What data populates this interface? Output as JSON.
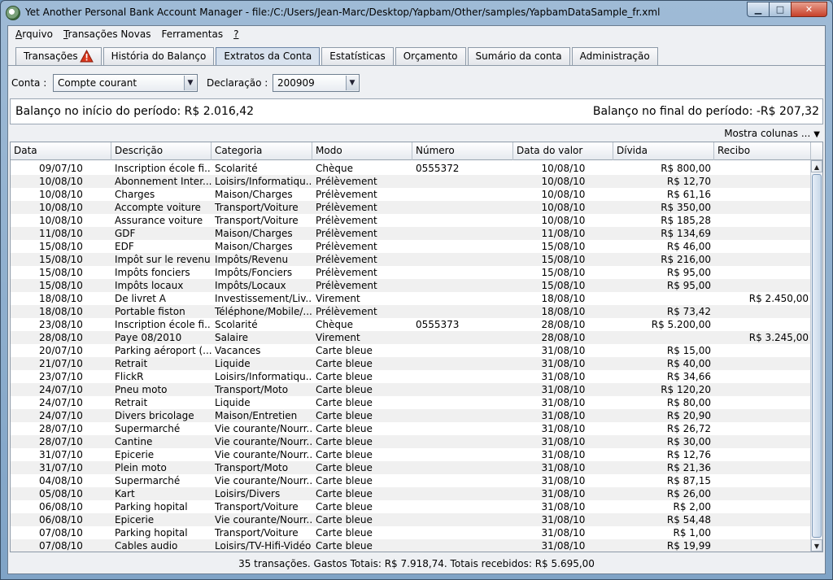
{
  "window": {
    "title": "Yet Another Personal Bank Account Manager - file:/C:/Users/Jean-Marc/Desktop/Yapbam/Other/samples/YapbamDataSample_fr.xml",
    "minimize_glyph": "▁",
    "maximize_glyph": "□",
    "close_glyph": "✕"
  },
  "menu": {
    "items": [
      {
        "label": "Arquivo",
        "mnemonic": "A",
        "rest": "rquivo"
      },
      {
        "label": "Transações Novas",
        "mnemonic": "T",
        "rest": "ransações Novas"
      },
      {
        "label": "Ferramentas",
        "mnemonic": "",
        "rest": "Ferramentas"
      },
      {
        "label": "?",
        "mnemonic": "?",
        "rest": ""
      }
    ]
  },
  "tabs": [
    {
      "label": "Transações",
      "warning_icon": true
    },
    {
      "label": "História do Balanço"
    },
    {
      "label": "Extratos da Conta",
      "active": true
    },
    {
      "label": "Estatísticas"
    },
    {
      "label": "Orçamento"
    },
    {
      "label": "Sumário da conta"
    },
    {
      "label": "Administração"
    }
  ],
  "filters": {
    "account_label": "Conta :",
    "account_value": "Compte courant",
    "statement_label": "Declaração :",
    "statement_value": "200909"
  },
  "balance": {
    "start": "Balanço no início do período: R$ 2.016,42",
    "end": "Balanço no final do período: -R$ 207,32"
  },
  "columns_link": "Mostra colunas ...",
  "table": {
    "headers": [
      "Data",
      "Descrição",
      "Categoria",
      "Modo",
      "Número",
      "Data do valor",
      "Dívida",
      "Recibo"
    ],
    "rows": [
      [
        "09/07/10",
        "Inscription école fi...",
        "Scolarité",
        "Chèque",
        "0555372",
        "10/08/10",
        "R$ 800,00",
        ""
      ],
      [
        "10/08/10",
        "Abonnement Inter...",
        "Loisirs/Informatiqu...",
        "Prélèvement",
        "",
        "10/08/10",
        "R$ 12,70",
        ""
      ],
      [
        "10/08/10",
        "Charges",
        "Maison/Charges",
        "Prélèvement",
        "",
        "10/08/10",
        "R$ 61,16",
        ""
      ],
      [
        "10/08/10",
        "Accompte voiture",
        "Transport/Voiture",
        "Prélèvement",
        "",
        "10/08/10",
        "R$ 350,00",
        ""
      ],
      [
        "10/08/10",
        "Assurance voiture",
        "Transport/Voiture",
        "Prélèvement",
        "",
        "10/08/10",
        "R$ 185,28",
        ""
      ],
      [
        "11/08/10",
        "GDF",
        "Maison/Charges",
        "Prélèvement",
        "",
        "11/08/10",
        "R$ 134,69",
        ""
      ],
      [
        "15/08/10",
        "EDF",
        "Maison/Charges",
        "Prélèvement",
        "",
        "15/08/10",
        "R$ 46,00",
        ""
      ],
      [
        "15/08/10",
        "Impôt sur le revenu",
        "Impôts/Revenu",
        "Prélèvement",
        "",
        "15/08/10",
        "R$ 216,00",
        ""
      ],
      [
        "15/08/10",
        "Impôts fonciers",
        "Impôts/Fonciers",
        "Prélèvement",
        "",
        "15/08/10",
        "R$ 95,00",
        ""
      ],
      [
        "15/08/10",
        "Impôts locaux",
        "Impôts/Locaux",
        "Prélèvement",
        "",
        "15/08/10",
        "R$ 95,00",
        ""
      ],
      [
        "18/08/10",
        "De livret A",
        "Investissement/Liv...",
        "Virement",
        "",
        "18/08/10",
        "",
        "R$ 2.450,00"
      ],
      [
        "18/08/10",
        "Portable fiston",
        "Téléphone/Mobile/...",
        "Prélèvement",
        "",
        "18/08/10",
        "R$ 73,42",
        ""
      ],
      [
        "23/08/10",
        "Inscription école fi...",
        "Scolarité",
        "Chèque",
        "0555373",
        "28/08/10",
        "R$ 5.200,00",
        ""
      ],
      [
        "28/08/10",
        "Paye 08/2010",
        "Salaire",
        "Virement",
        "",
        "28/08/10",
        "",
        "R$ 3.245,00"
      ],
      [
        "20/07/10",
        "Parking aéroport (...",
        "Vacances",
        "Carte bleue",
        "",
        "31/08/10",
        "R$ 15,00",
        ""
      ],
      [
        "21/07/10",
        "Retrait",
        "Liquide",
        "Carte bleue",
        "",
        "31/08/10",
        "R$ 40,00",
        ""
      ],
      [
        "23/07/10",
        "FlickR",
        "Loisirs/Informatiqu...",
        "Carte bleue",
        "",
        "31/08/10",
        "R$ 34,66",
        ""
      ],
      [
        "24/07/10",
        "Pneu moto",
        "Transport/Moto",
        "Carte bleue",
        "",
        "31/08/10",
        "R$ 120,20",
        ""
      ],
      [
        "24/07/10",
        "Retrait",
        "Liquide",
        "Carte bleue",
        "",
        "31/08/10",
        "R$ 80,00",
        ""
      ],
      [
        "24/07/10",
        "Divers bricolage",
        "Maison/Entretien",
        "Carte bleue",
        "",
        "31/08/10",
        "R$ 20,90",
        ""
      ],
      [
        "28/07/10",
        "Supermarché",
        "Vie courante/Nourr...",
        "Carte bleue",
        "",
        "31/08/10",
        "R$ 26,72",
        ""
      ],
      [
        "28/07/10",
        "Cantine",
        "Vie courante/Nourr...",
        "Carte bleue",
        "",
        "31/08/10",
        "R$ 30,00",
        ""
      ],
      [
        "31/07/10",
        "Epicerie",
        "Vie courante/Nourr...",
        "Carte bleue",
        "",
        "31/08/10",
        "R$ 12,76",
        ""
      ],
      [
        "31/07/10",
        "Plein moto",
        "Transport/Moto",
        "Carte bleue",
        "",
        "31/08/10",
        "R$ 21,36",
        ""
      ],
      [
        "04/08/10",
        "Supermarché",
        "Vie courante/Nourr...",
        "Carte bleue",
        "",
        "31/08/10",
        "R$ 87,15",
        ""
      ],
      [
        "05/08/10",
        "Kart",
        "Loisirs/Divers",
        "Carte bleue",
        "",
        "31/08/10",
        "R$ 26,00",
        ""
      ],
      [
        "06/08/10",
        "Parking hopital",
        "Transport/Voiture",
        "Carte bleue",
        "",
        "31/08/10",
        "R$ 2,00",
        ""
      ],
      [
        "06/08/10",
        "Epicerie",
        "Vie courante/Nourr...",
        "Carte bleue",
        "",
        "31/08/10",
        "R$ 54,48",
        ""
      ],
      [
        "07/08/10",
        "Parking hopital",
        "Transport/Voiture",
        "Carte bleue",
        "",
        "31/08/10",
        "R$ 1,00",
        ""
      ],
      [
        "07/08/10",
        "Cables audio",
        "Loisirs/TV-Hifi-Vidéo",
        "Carte bleue",
        "",
        "31/08/10",
        "R$ 19,99",
        ""
      ]
    ]
  },
  "status_text": "35 transações. Gastos Totais: R$ 7.918,74. Totais recebidos: R$ 5.695,00",
  "colors": {
    "active_tab": "#d8e2ee",
    "row_alt": "#f0f0f0",
    "warning": "#d9361c"
  }
}
